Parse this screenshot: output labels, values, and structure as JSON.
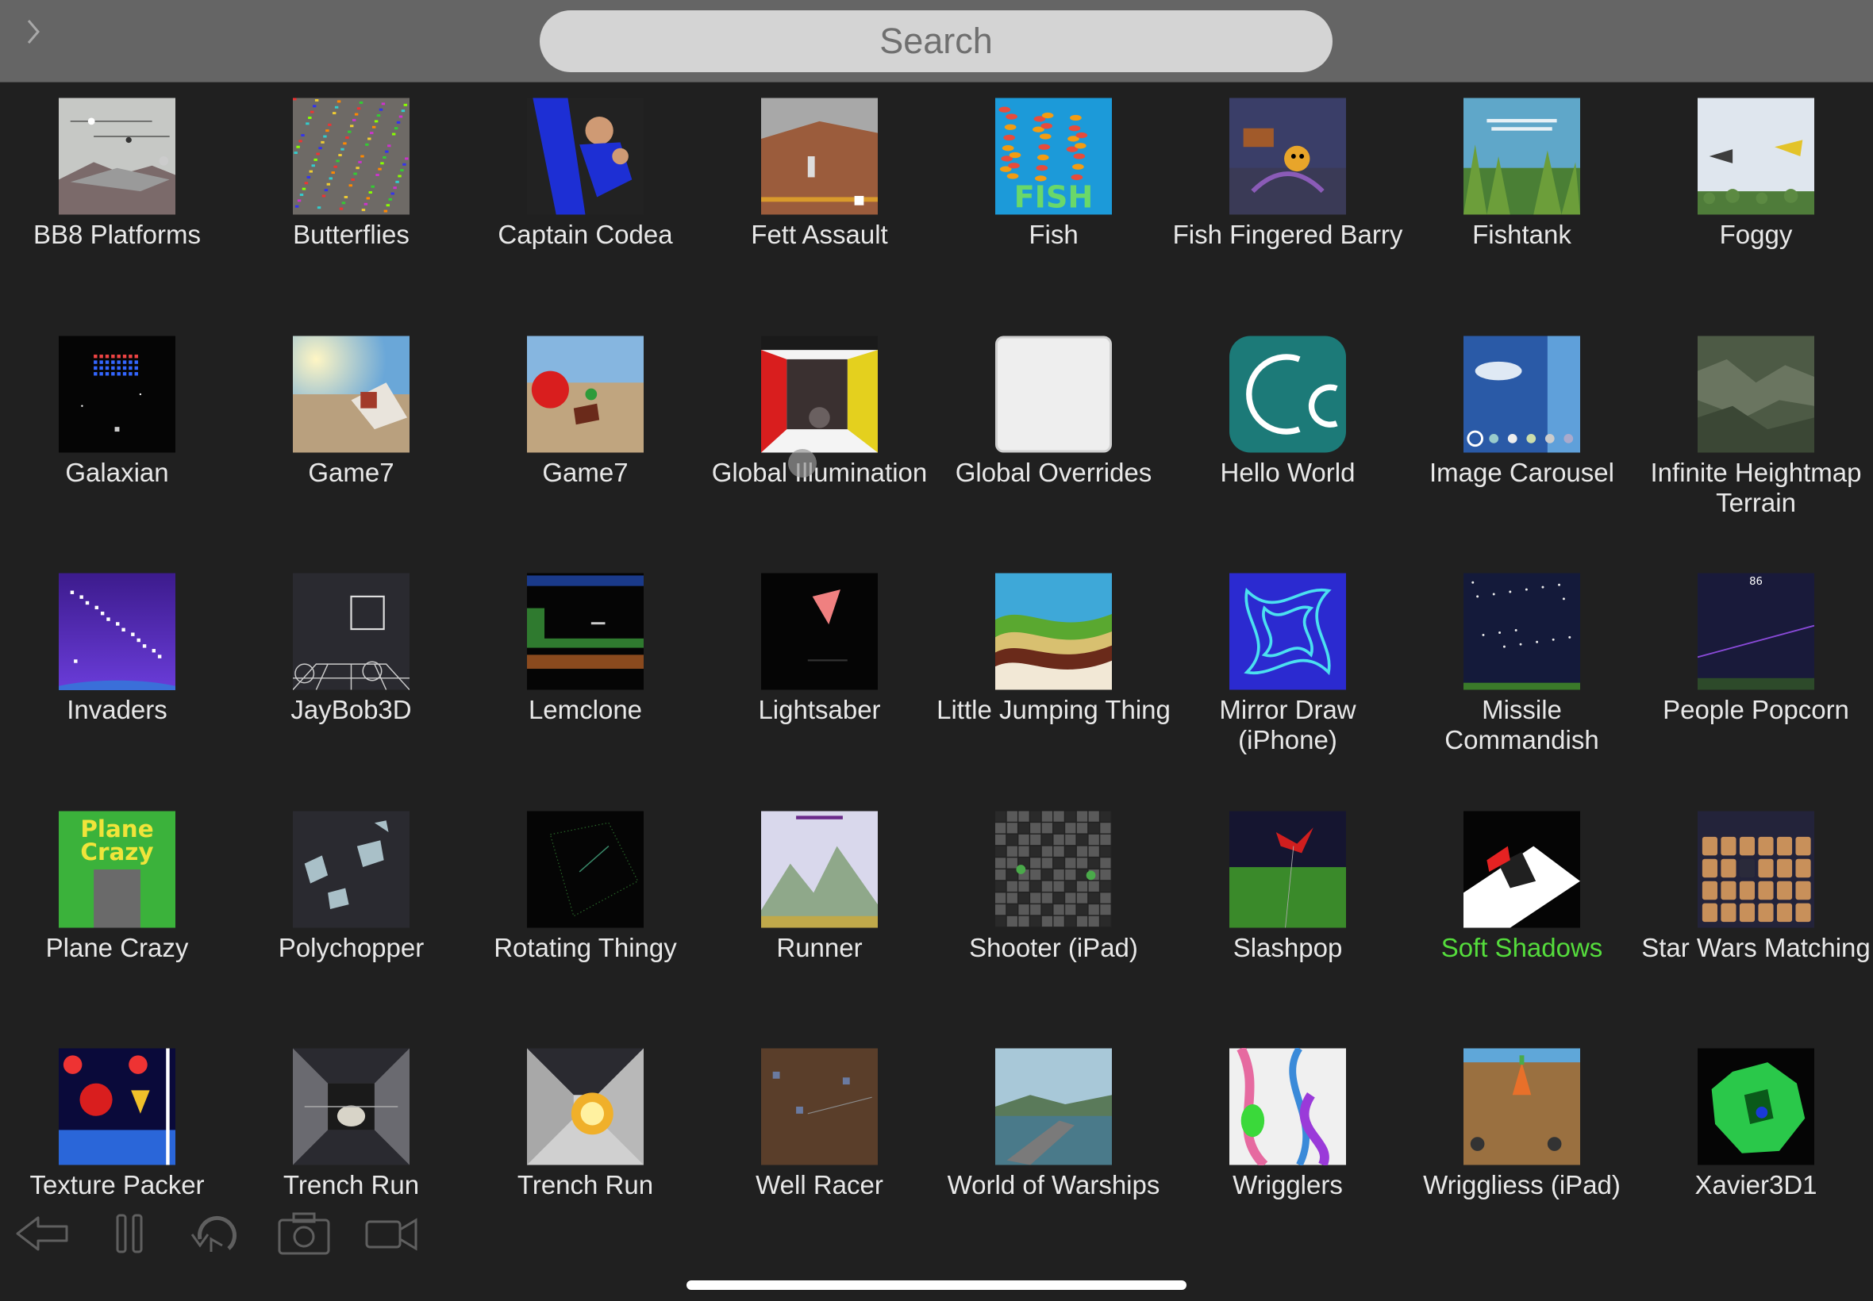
{
  "search": {
    "placeholder": "Search"
  },
  "colors": {
    "background": "#202020",
    "topbar": "#656565",
    "label": "#e8e8e8",
    "selected_label": "#55dd3c"
  },
  "projects": [
    {
      "name": "BB8 Platforms",
      "thumb": "bb8"
    },
    {
      "name": "Butterflies",
      "thumb": "butterflies"
    },
    {
      "name": "Captain Codea",
      "thumb": "captain"
    },
    {
      "name": "Fett Assault",
      "thumb": "fett"
    },
    {
      "name": "Fish",
      "thumb": "fish",
      "thumb_text": "FISH"
    },
    {
      "name": "Fish Fingered Barry",
      "thumb": "barry"
    },
    {
      "name": "Fishtank",
      "thumb": "fishtank"
    },
    {
      "name": "Foggy",
      "thumb": "foggy"
    },
    {
      "name": "Galaxian",
      "thumb": "galaxian"
    },
    {
      "name": "Game7",
      "thumb": "game7a"
    },
    {
      "name": "Game7",
      "thumb": "game7b"
    },
    {
      "name": "Global Illumination",
      "thumb": "global_illum"
    },
    {
      "name": "Global Overrides",
      "thumb": "blank"
    },
    {
      "name": "Hello World",
      "thumb": "codea_logo"
    },
    {
      "name": "Image Carousel",
      "thumb": "carousel"
    },
    {
      "name": "Infinite Heightmap Terrain",
      "thumb": "terrain"
    },
    {
      "name": "Invaders",
      "thumb": "invaders"
    },
    {
      "name": "JayBob3D",
      "thumb": "jaybob"
    },
    {
      "name": "Lemclone",
      "thumb": "lemclone"
    },
    {
      "name": "Lightsaber",
      "thumb": "lightsaber"
    },
    {
      "name": "Little Jumping Thing",
      "thumb": "waves"
    },
    {
      "name": "Mirror Draw (iPhone)",
      "thumb": "mirror"
    },
    {
      "name": "Missile Commandish",
      "thumb": "missile"
    },
    {
      "name": "People Popcorn",
      "thumb": "popcorn",
      "thumb_text": "86"
    },
    {
      "name": "Plane Crazy",
      "thumb": "planecrazy",
      "thumb_text": "Plane Crazy"
    },
    {
      "name": "Polychopper",
      "thumb": "polychopper"
    },
    {
      "name": "Rotating Thingy",
      "thumb": "rotating"
    },
    {
      "name": "Runner",
      "thumb": "runner"
    },
    {
      "name": "Shooter (iPad)",
      "thumb": "shooter"
    },
    {
      "name": "Slashpop",
      "thumb": "slashpop"
    },
    {
      "name": "Soft Shadows",
      "thumb": "softshadows",
      "selected": true
    },
    {
      "name": "Star Wars Matching",
      "thumb": "matching"
    },
    {
      "name": "Texture Packer",
      "thumb": "texture"
    },
    {
      "name": "Trench Run",
      "thumb": "trench1"
    },
    {
      "name": "Trench Run",
      "thumb": "trench2"
    },
    {
      "name": "Well Racer",
      "thumb": "wellracer"
    },
    {
      "name": "World of Warships",
      "thumb": "warships"
    },
    {
      "name": "Wrigglers",
      "thumb": "wrigglers"
    },
    {
      "name": "Wriggliess (iPad)",
      "thumb": "wriggliess"
    },
    {
      "name": "Xavier3D1",
      "thumb": "xavier"
    }
  ],
  "toolbar": [
    {
      "icon": "back-arrow-icon"
    },
    {
      "icon": "pause-icon"
    },
    {
      "icon": "restart-icon"
    },
    {
      "icon": "camera-icon"
    },
    {
      "icon": "video-camera-icon"
    }
  ]
}
